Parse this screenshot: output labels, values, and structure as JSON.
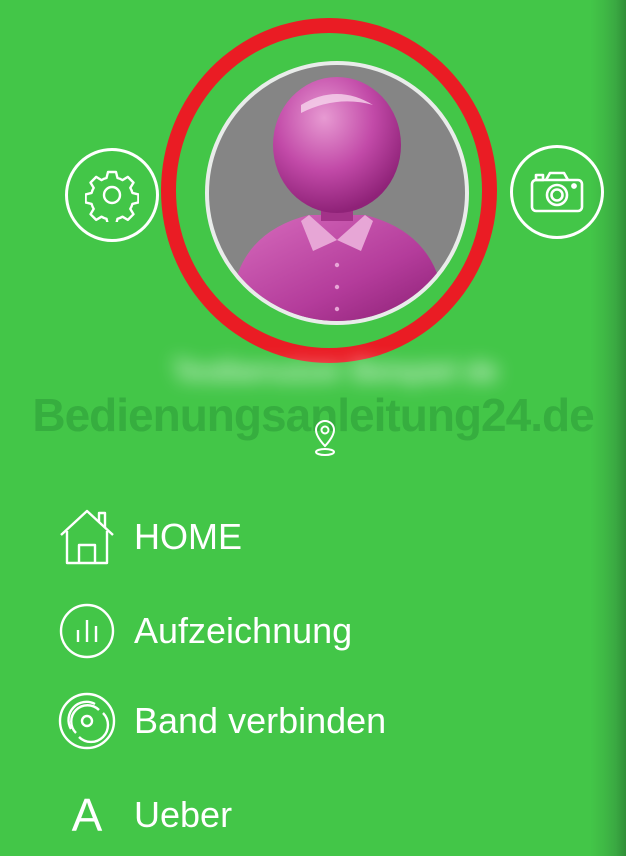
{
  "profile": {
    "name": "Testbenutzer Beispiel de",
    "avatar_icon": "person-silhouette-icon",
    "highlight_color": "#ea1c24"
  },
  "watermark": "Bedienungsanleitung24.de",
  "buttons": {
    "settings_icon": "gear-icon",
    "camera_icon": "camera-icon"
  },
  "location_icon": "map-pin-icon",
  "menu": {
    "items": [
      {
        "label": "HOME",
        "icon": "house-icon"
      },
      {
        "label": "Aufzeichnung",
        "icon": "bar-chart-circle-icon"
      },
      {
        "label": "Band verbinden",
        "icon": "band-connect-icon"
      },
      {
        "label": "Ueber",
        "icon": "letter-a-icon",
        "glyph": "A"
      }
    ]
  },
  "colors": {
    "background": "#43c648",
    "foreground": "#ffffff",
    "avatar_bg": "#858585",
    "avatar_figure": "#c24aa8"
  }
}
